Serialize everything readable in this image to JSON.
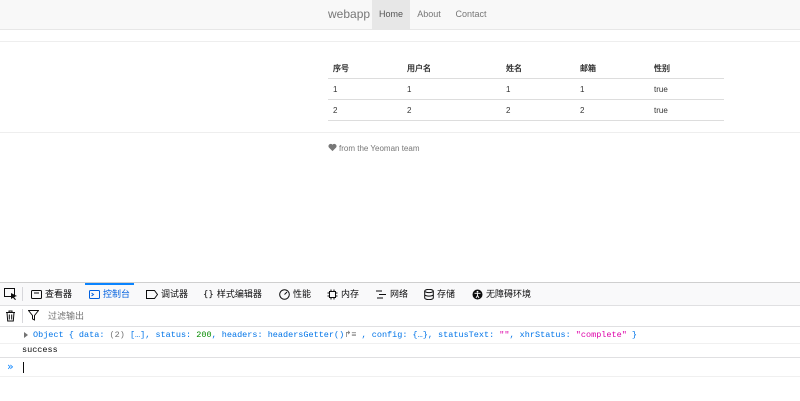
{
  "navbar": {
    "brand": "webapp",
    "items": [
      {
        "label": "Home",
        "active": true
      },
      {
        "label": "About",
        "active": false
      },
      {
        "label": "Contact",
        "active": false
      }
    ]
  },
  "table": {
    "headers": [
      "序号",
      "用户名",
      "姓名",
      "邮箱",
      "性别"
    ],
    "rows": [
      [
        "1",
        "1",
        "1",
        "1",
        "true"
      ],
      [
        "2",
        "2",
        "2",
        "2",
        "true"
      ]
    ]
  },
  "footer": {
    "text": "from the Yeoman team",
    "icon": "heart-icon"
  },
  "devtools": {
    "tabs": [
      {
        "label": "查看器",
        "icon": "inspector-icon"
      },
      {
        "label": "控制台",
        "icon": "console-icon",
        "active": true
      },
      {
        "label": "调试器",
        "icon": "debugger-icon"
      },
      {
        "label": "样式编辑器",
        "icon": "style-editor-icon"
      },
      {
        "label": "性能",
        "icon": "performance-icon"
      },
      {
        "label": "内存",
        "icon": "memory-icon"
      },
      {
        "label": "网络",
        "icon": "network-icon"
      },
      {
        "label": "存储",
        "icon": "storage-icon"
      },
      {
        "label": "无障碍环境",
        "icon": "accessibility-icon"
      }
    ],
    "filter_placeholder": "过滤输出",
    "log": {
      "object_prefix": "Object { ",
      "data_key": "data: ",
      "data_count": "(2) ",
      "data_val": "[…]",
      "sep1": ", ",
      "status_key": "status: ",
      "status_val": "200",
      "headers_key": ", headers: ",
      "headers_val": "headersGetter()",
      "headers_sym": "↱≡",
      "config_key": " , config: ",
      "config_val": "{…}",
      "statusText_key": ", statusText: ",
      "statusText_val": "\"\"",
      "xhr_key": ", xhrStatus: ",
      "xhr_val": "\"complete\"",
      "object_suffix": " }",
      "success_line": "success"
    },
    "prompt_symbol": "»"
  }
}
